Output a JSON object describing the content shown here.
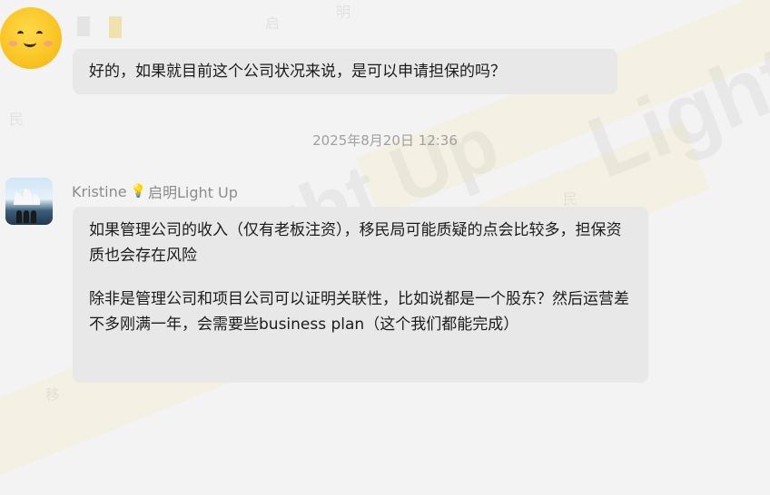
{
  "messages": [
    {
      "text": "好的，如果就目前这个公司状况来说，是可以申请担保的吗？"
    }
  ],
  "timestamp": "2025年8月20日 12:36",
  "reply": {
    "sender_name": "Kristine",
    "sender_org": "启明Light Up",
    "paragraphs": [
      "如果管理公司的收入（仅有老板注资），移民局可能质疑的点会比较多，担保资质也会存在风险",
      "除非是管理公司和项目公司可以证明关联性，比如说都是一个股东？然后运营差不多刚满一年，会需要些business plan（这个我们都能完成）"
    ]
  },
  "watermark": {
    "brand": "Light Up",
    "chars": [
      "启",
      "明",
      "移",
      "民"
    ]
  }
}
